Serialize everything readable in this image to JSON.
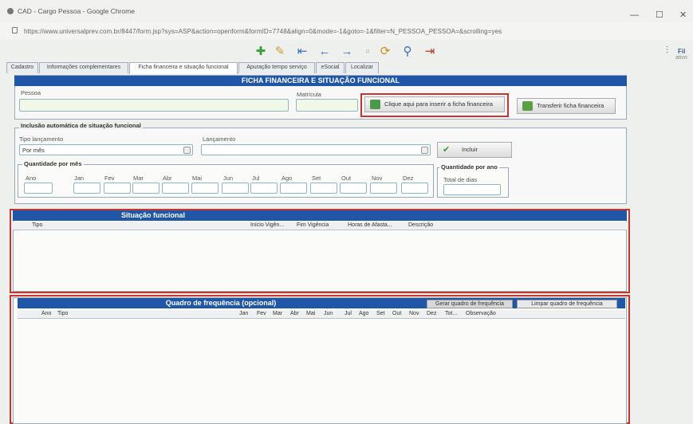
{
  "window": {
    "title": "CAD - Cargo Pessoa - Google Chrome",
    "url": "https://www.universalprev.com.br/8447/form.jsp?sys=ASP&action=openform&formID=7748&align=0&mode=-1&goto=-1&filter=N_PESSOA_PESSOA=&scrolling=yes",
    "minimize": "—",
    "maximize": "☐",
    "close": "✕"
  },
  "toolbar": {
    "icons": [
      "add-icon",
      "edit-icon",
      "first-icon",
      "prev-icon",
      "next-icon",
      "last-icon",
      "refresh-icon",
      "search-icon",
      "exit-icon"
    ],
    "right_label": "Fil",
    "right_sub": "ativo"
  },
  "tabs": [
    {
      "label": "Cadastro"
    },
    {
      "label": "Informações complementares"
    },
    {
      "label": "Ficha financeira e situação funcional"
    },
    {
      "label": "Apuração tempo serviço"
    },
    {
      "label": "eSocial"
    },
    {
      "label": "Localizar"
    }
  ],
  "ficha": {
    "title": "FICHA FINANCEIRA E SITUAÇÃO FUNCIONAL",
    "pessoa_label": "Pessoa",
    "pessoa_value": "",
    "matricula_label": "Matrícula",
    "matricula_value": "",
    "insert_button": "Clique aqui para inserir a ficha financeira",
    "transfer_button": "Transferir ficha financeira"
  },
  "inclusao": {
    "title": "Inclusão automática de situação funcional",
    "tipo_label": "Tipo lançamento",
    "tipo_value": "Por mês",
    "lancamento_label": "Lançamento",
    "lancamento_value": "",
    "incluir_button": "Incluir",
    "por_mes_title": "Quantidade por mês",
    "months": [
      "Ano",
      "Jan",
      "Fev",
      "Mar",
      "Abr",
      "Mai",
      "Jun",
      "Jul",
      "Ago",
      "Set",
      "Out",
      "Nov",
      "Dez"
    ],
    "por_ano_title": "Quantidade por ano",
    "total_dias_label": "Total de dias"
  },
  "situacao": {
    "title": "Situação funcional",
    "columns": [
      "Tipo",
      "Início Vigên...",
      "Fim Vigência",
      "Horas de Afasta...",
      "Descrição"
    ]
  },
  "quadro": {
    "title": "Quadro de frequência (opcional)",
    "gerar_button": "Gerar quadro de frequência",
    "limpar_button": "Limpar quadro de frequência",
    "columns": [
      "Ano",
      "Tipo",
      "Jan",
      "Fev",
      "Mar",
      "Abr",
      "Mai",
      "Jun",
      "Jul",
      "Ago",
      "Set",
      "Out",
      "Nov",
      "Dez",
      "Tot...",
      "Observação"
    ]
  },
  "colors": {
    "header_blue": "#1f56a8",
    "highlight_red": "#c8352d"
  }
}
